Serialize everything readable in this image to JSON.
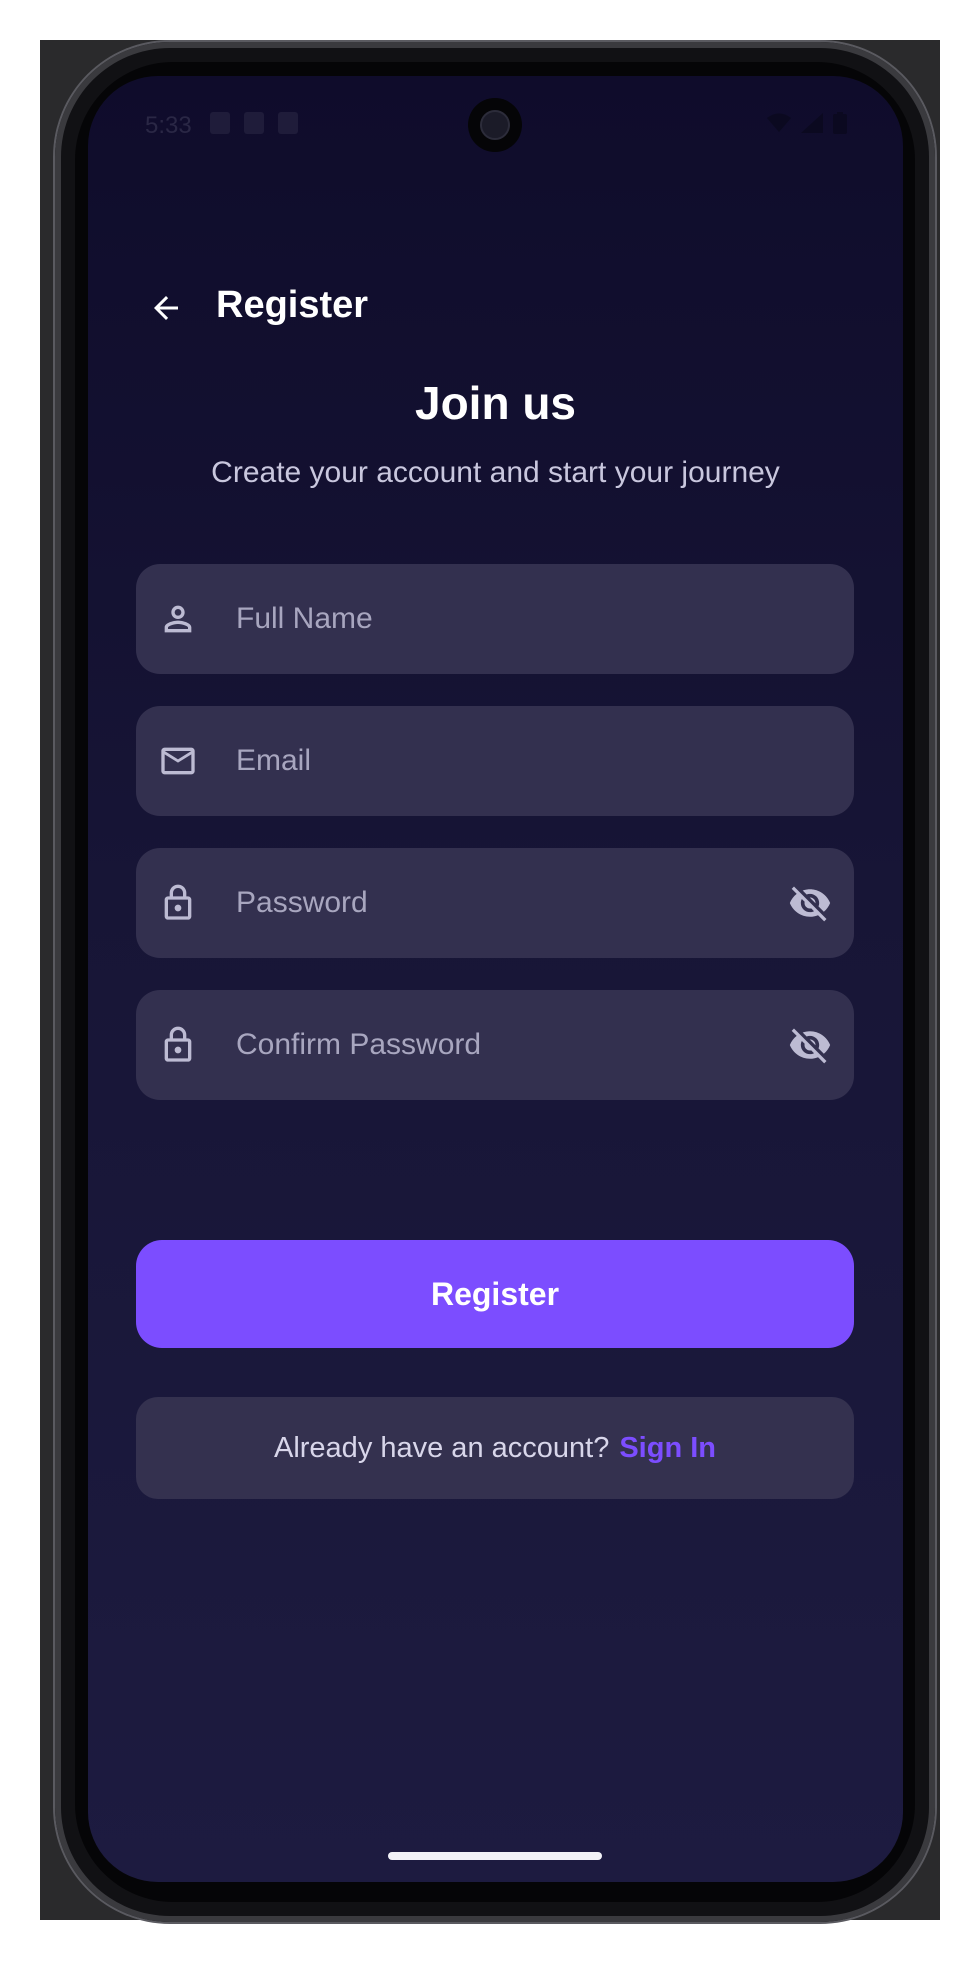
{
  "status_bar": {
    "time": "5:33"
  },
  "app_bar": {
    "title": "Register"
  },
  "hero": {
    "headline": "Join us",
    "subtitle": "Create your account and start your journey"
  },
  "form": {
    "full_name": {
      "placeholder": "Full Name",
      "value": ""
    },
    "email": {
      "placeholder": "Email",
      "value": ""
    },
    "password": {
      "placeholder": "Password",
      "value": ""
    },
    "confirm_password": {
      "placeholder": "Confirm Password",
      "value": ""
    }
  },
  "register_button": {
    "label": "Register"
  },
  "signin": {
    "prompt": "Already have an account?",
    "link": "Sign In"
  },
  "icons": {
    "back": "arrow-back-icon",
    "full_name": "person-icon",
    "email": "mail-icon",
    "password": "lock-icon",
    "password_toggle": "visibility-off-icon"
  },
  "colors": {
    "background_top": "#0f0c2b",
    "background_bottom": "#1d1b40",
    "field_background": "#33304f",
    "accent": "#7c4dff",
    "text_primary": "#ffffff",
    "text_secondary": "#c9c7de",
    "placeholder": "#a8a6bf"
  }
}
